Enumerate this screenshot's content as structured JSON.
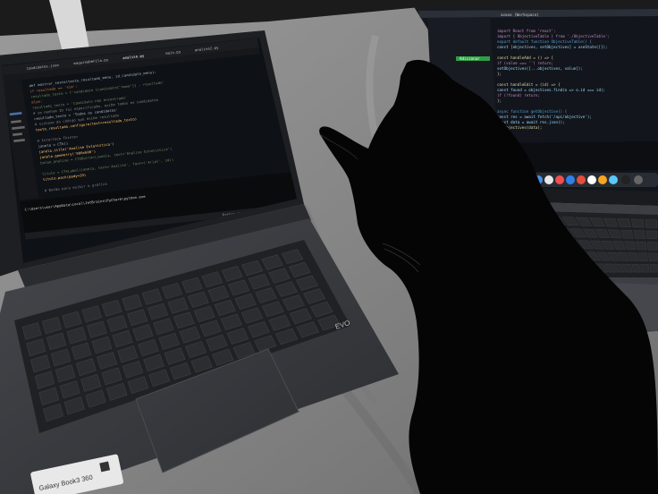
{
  "left_laptop": {
    "tabs": [
      "Candidatos.json",
      "maquinaDeFila.py",
      "analise.py",
      "main.py",
      "analise2.py"
    ],
    "code_lines": [
      "def mostrar_texto(texto_resultado_menu, id_candidato_menu):",
      "    if resultado == 'sim':",
      "        resultado_texto = f'candidato {candidato[\"nome\"]} - resultado'",
      "    else:",
      "        resultado_texto = 'Candidato não encontrado'",
      "    # se nenhum ID foi especificado, exibe todos os candidatos",
      "    resultado_texto = 'Todos os candidatos'",
      "    # sintaxe do código que exibe resultado",
      "    texto_resultado.configure(text=resultado_texto)",
      "",
      "    # Interface Tkinter",
      "    janela = CTk()",
      "    janela.title('Analise Estatistica')",
      "    janela.geometry('800x600')",
      "    botao_analise = CTkButton(janela, text='Analise Estatistica')",
      "",
      "    titulo = CTkLabel(janela, text='Analise', font=('Arial', 24))",
      "    titulo.pack(pady=20)",
      "",
      "    # Botão para exibir o gráfico"
    ],
    "terminal_line": "C:\\Users\\user\\AppData\\Local\\JetBrains\\PyCharm\\python.exe",
    "status_text": "Python 3.12",
    "sticker_text": "Galaxy Book3 360",
    "evo_text": "EVO"
  },
  "right_laptop": {
    "window_title": "avaxo (Workspace)",
    "code_lines": [
      "import React from 'react';",
      "import { ObjectiveTable } from './ObjectiveTable';",
      "export default function ObjectiveTable() {",
      "  const [objectives, setObjectives] = useState([]);",
      "",
      "  const handleAdd = () => {",
      "    if (value === '') return;",
      "    setObjectives([...objectives, value]);",
      "  };",
      "",
      "  const handleEdit = (id) => {",
      "    const found = objectives.find(o => o.id === id);",
      "    if (!found) return;",
      "  };",
      "",
      "  async function getObjective() {",
      "    const res = await fetch('/api/objective');",
      "    const data = await res.json();",
      "    setObjectives(data);",
      "  }"
    ],
    "button_text": "Adicionar"
  },
  "colors": {
    "sheet": "#8e8e8e",
    "laptop_body": "#3a3c40",
    "laptop_dark": "#232427",
    "screen_bg": "#0e1116",
    "cat": "#050505",
    "keyword": "#cc7832",
    "string": "#6a8759",
    "identifier": "#a9b7c6",
    "function": "#ffc66d",
    "green_button": "#2ea043"
  }
}
